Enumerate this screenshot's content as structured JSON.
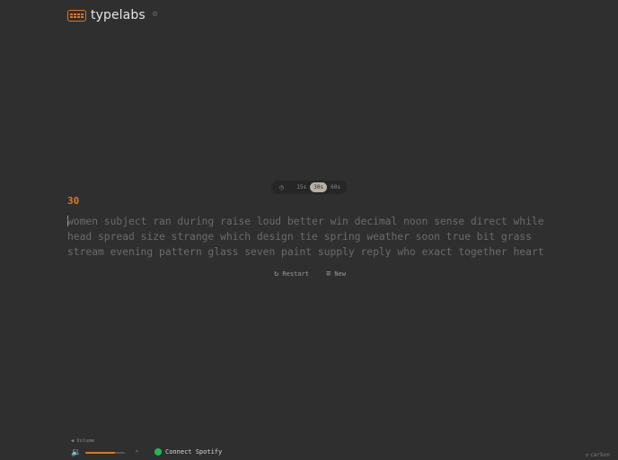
{
  "app": {
    "brand": "typelabs"
  },
  "mode": {
    "options": [
      "15s",
      "30s",
      "60s"
    ],
    "selected": "30s"
  },
  "counter": "30",
  "words": {
    "lines": [
      "women subject ran during raise loud better win decimal noon sense direct while",
      "head spread size strange which design tie spring weather soon true bit grass",
      "stream evening pattern glass seven paint supply reply who exact together heart"
    ]
  },
  "actions": {
    "restart": "Restart",
    "new": "New"
  },
  "volume": {
    "label": "Volume",
    "level": 0.75
  },
  "spotify": {
    "label": "Connect Spotify"
  },
  "theme": {
    "name": "carbon"
  },
  "colors": {
    "accent": "#e0761e",
    "background": "#2f2f2f",
    "spotify": "#1db954"
  },
  "icons": [
    "keyboard-logo-icon",
    "settings-icon",
    "timer-icon",
    "restart-icon",
    "new-icon",
    "volume-icon",
    "speaker-icon",
    "chevron-up-icon",
    "spotify-icon",
    "palette-icon"
  ]
}
